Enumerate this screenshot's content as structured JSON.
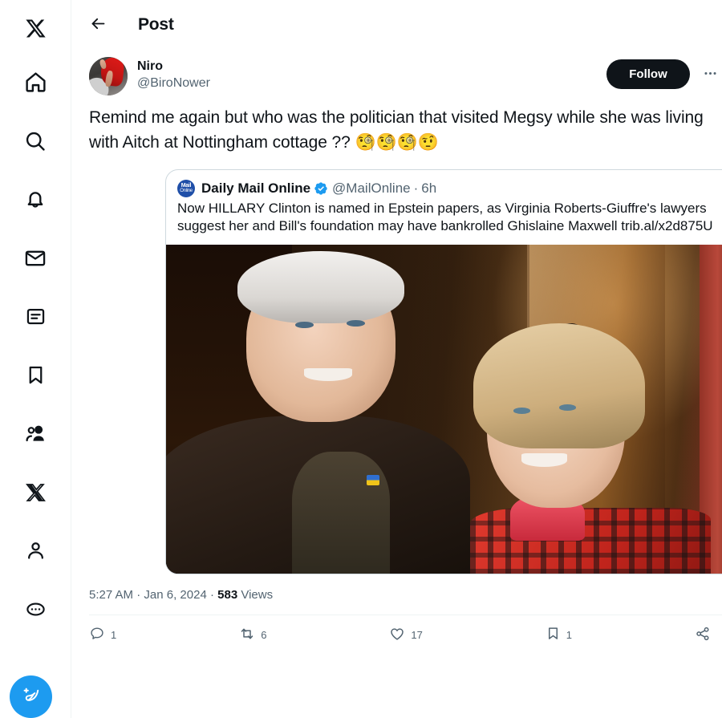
{
  "sidebar": {
    "items": [
      {
        "name": "x-logo-icon",
        "label": "X"
      },
      {
        "name": "home-icon",
        "label": "Home"
      },
      {
        "name": "search-icon",
        "label": "Explore"
      },
      {
        "name": "bell-icon",
        "label": "Notifications"
      },
      {
        "name": "envelope-icon",
        "label": "Messages"
      },
      {
        "name": "list-icon",
        "label": "Lists"
      },
      {
        "name": "bookmark-icon",
        "label": "Bookmarks"
      },
      {
        "name": "communities-icon",
        "label": "Communities"
      },
      {
        "name": "premium-x-icon",
        "label": "Premium"
      },
      {
        "name": "profile-icon",
        "label": "Profile"
      },
      {
        "name": "more-dots-icon",
        "label": "More"
      }
    ],
    "compose": {
      "label": "Post",
      "icon": "compose-feather-icon",
      "color": "#1d9bf0"
    }
  },
  "header": {
    "back_icon": "arrow-left-icon",
    "title": "Post"
  },
  "post": {
    "author": {
      "display_name": "Niro",
      "handle": "@BiroNower",
      "avatar": "user-avatar"
    },
    "follow_label": "Follow",
    "more_icon": "more-dots-icon",
    "text_part1": "Remind me again but who was the politician that visited Megsy while she was living with Aitch at Nottingham cottage ?? ",
    "emojis": "🧐🧐🧐🤨",
    "timestamp_time": "5:27 AM",
    "timestamp_sep1": " · ",
    "timestamp_date": "Jan 6, 2024",
    "timestamp_sep2": " · ",
    "views_count": "583",
    "views_label": " Views"
  },
  "quoted": {
    "avatar_line1": "Mail",
    "avatar_line2": "Online",
    "display_name": "Daily Mail Online",
    "verified": true,
    "verified_icon": "verified-badge-icon",
    "handle": "@MailOnline",
    "separator": "·",
    "time": "6h",
    "text": "Now HILLARY Clinton is named in Epstein papers, as Virginia Roberts-Giuffre's lawyers suggest her and Bill's foundation may have bankrolled Ghislaine Maxwell trib.al/x2d875U",
    "image_alt": "Bill Clinton and Hillary Clinton smiling"
  },
  "actions": [
    {
      "name": "reply-button",
      "icon": "reply-icon",
      "count": "1"
    },
    {
      "name": "retweet-button",
      "icon": "retweet-icon",
      "count": "6"
    },
    {
      "name": "like-button",
      "icon": "heart-icon",
      "count": "17"
    },
    {
      "name": "bookmark-button",
      "icon": "bookmark-icon",
      "count": "1"
    },
    {
      "name": "share-button",
      "icon": "share-icon",
      "count": ""
    }
  ],
  "colors": {
    "accent": "#1d9bf0",
    "text": "#0f1419",
    "muted": "#536471",
    "border": "#eff3f4",
    "card_border": "#cfd9de",
    "verified": "#1d9bf0",
    "follow_bg": "#0f1419"
  }
}
